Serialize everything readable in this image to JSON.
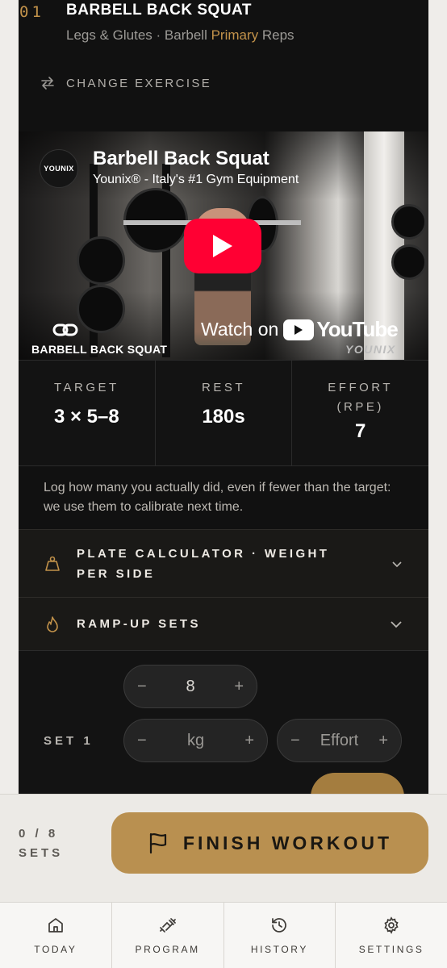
{
  "exercise": {
    "index": "01",
    "title": "BARBELL BACK SQUAT",
    "muscle": "Legs & Glutes",
    "separator": "·",
    "equipment": "Barbell",
    "role": "Primary",
    "mode": "Reps",
    "change_label": "CHANGE EXERCISE"
  },
  "video": {
    "title": "Barbell Back Squat",
    "channel": "Younix® - Italy's #1 Gym Equipment",
    "channel_logo": "YOUNIX",
    "watch_on": "Watch on",
    "youtube": "YouTube",
    "watermark": "BARBELL BACK SQUAT",
    "brand": "YOUNIX",
    "play_color": "#ff0033"
  },
  "stats": [
    {
      "label": "TARGET",
      "value": "3 × 5–8"
    },
    {
      "label": "REST",
      "value": "180s"
    },
    {
      "label": "EFFORT (RPE)",
      "value": "7"
    }
  ],
  "hint": "Log how many you actually did, even if fewer than the target: we use them to calibrate next time.",
  "accordions": {
    "plate": {
      "label": "PLATE CALCULATOR · WEIGHT PER SIDE",
      "icon": "weight-icon"
    },
    "ramp": {
      "label": "RAMP-UP SETS",
      "icon": "flame-icon"
    }
  },
  "set": {
    "label": "SET 1",
    "reps": "8",
    "weight_placeholder": "kg",
    "effort_placeholder": "Effort",
    "minus": "−",
    "plus": "+"
  },
  "footer": {
    "progress_count": "0 / 8",
    "progress_label": "SETS",
    "finish_label": "FINISH WORKOUT"
  },
  "tabs": [
    {
      "label": "TODAY",
      "icon": "home-icon"
    },
    {
      "label": "PROGRAM",
      "icon": "dumbbell-icon"
    },
    {
      "label": "HISTORY",
      "icon": "history-icon"
    },
    {
      "label": "SETTINGS",
      "icon": "gear-icon"
    }
  ],
  "colors": {
    "accent": "#c2924a",
    "button": "#b99050",
    "card": "#111111",
    "background": "#efedea"
  }
}
